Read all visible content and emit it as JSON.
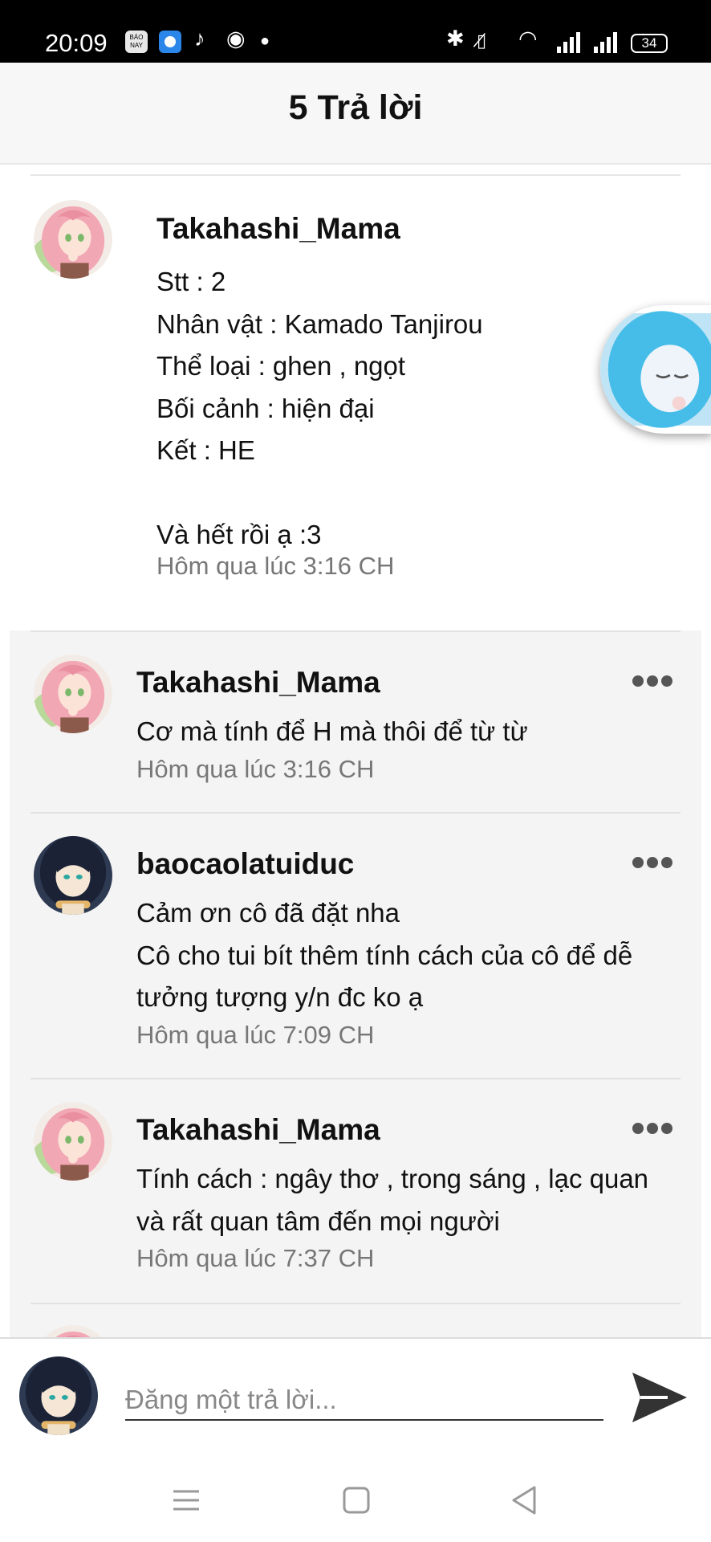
{
  "status_bar": {
    "time": "20:09",
    "app_icon_label": "BÁO NAY",
    "battery": "34",
    "icons": [
      "bao-nay-icon",
      "browser-icon",
      "tiktok-icon",
      "messenger-icon",
      "dot-icon",
      "bluetooth-icon",
      "vibrate-icon",
      "wifi-icon",
      "signal-icon",
      "battery-icon"
    ]
  },
  "header": {
    "title": "5 Trả lời"
  },
  "main_comment": {
    "author": "Takahashi_Mama",
    "lines": [
      "Stt : 2",
      "Nhân vật : Kamado Tanjirou",
      "Thể loại : ghen , ngọt",
      "Bối cảnh : hiện đại",
      "Kết : HE",
      "",
      "Và hết rồi ạ :3"
    ],
    "time": "Hôm qua lúc 3:16 CH"
  },
  "replies": [
    {
      "author": "Takahashi_Mama",
      "avatar": "pink-hair-avatar",
      "lines": [
        "Cơ mà tính để H mà thôi để từ từ"
      ],
      "time": "Hôm qua lúc 3:16 CH"
    },
    {
      "author": "baocaolatuiduc",
      "avatar": "dark-hair-avatar",
      "lines": [
        "Cảm ơn cô đã đặt nha",
        "Cô cho tui bít thêm tính cách của cô để dễ",
        "tưởng tượng y/n đc ko ạ"
      ],
      "time": "Hôm qua lúc 7:09 CH"
    },
    {
      "author": "Takahashi_Mama",
      "avatar": "pink-hair-avatar",
      "lines": [
        "Tính cách : ngây thơ , trong sáng , lạc quan",
        "và rất quan tâm đến mọi người"
      ],
      "time": "Hôm qua lúc 7:37 CH"
    }
  ],
  "compose": {
    "placeholder": "Đăng một trả lời..."
  },
  "colors": {
    "header_bg": "#f7f7f7",
    "reply_bg": "#f4f4f4",
    "time_text": "#777777",
    "send_icon": "#333333"
  }
}
